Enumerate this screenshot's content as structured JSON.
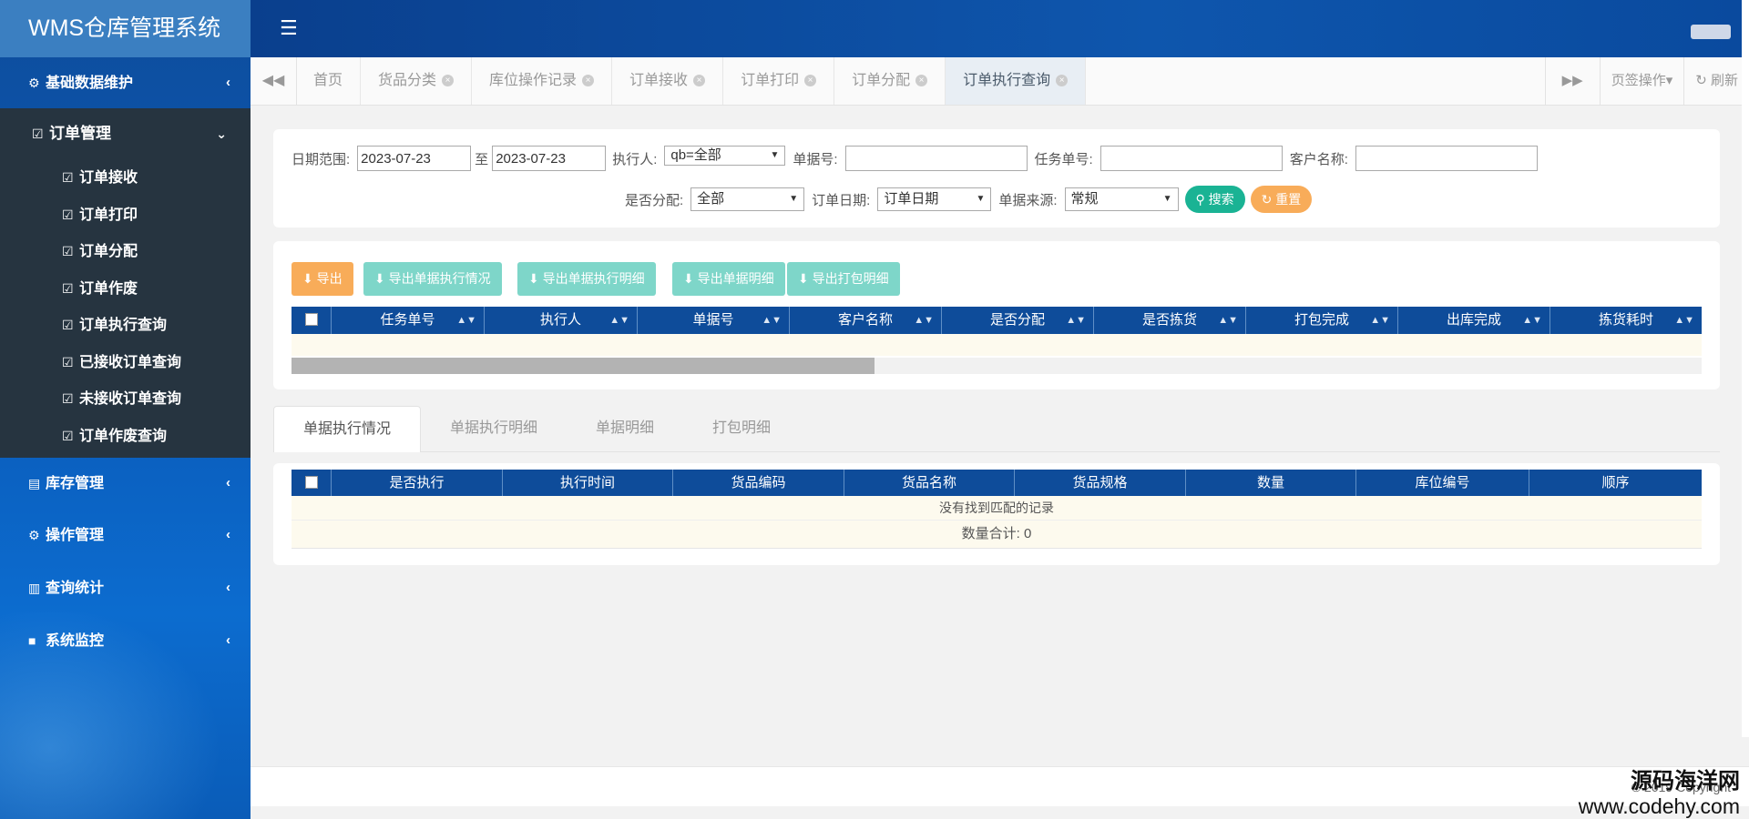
{
  "app": {
    "title": "WMS仓库管理系统"
  },
  "sidebar": {
    "groups": [
      {
        "label": "基础数据维护",
        "icon": "gear-icon"
      },
      {
        "label": "库存管理",
        "icon": "database-icon"
      },
      {
        "label": "操作管理",
        "icon": "cogs-icon"
      },
      {
        "label": "查询统计",
        "icon": "bar-chart-icon"
      },
      {
        "label": "系统监控",
        "icon": "video-camera-icon"
      }
    ],
    "order_section": {
      "label": "订单管理",
      "items": [
        "订单接收",
        "订单打印",
        "订单分配",
        "订单作废",
        "订单执行查询",
        "已接收订单查询",
        "未接收订单查询",
        "订单作废查询"
      ]
    }
  },
  "tabs": {
    "items": [
      {
        "label": "首页",
        "closable": false
      },
      {
        "label": "货品分类",
        "closable": true
      },
      {
        "label": "库位操作记录",
        "closable": true
      },
      {
        "label": "订单接收",
        "closable": true
      },
      {
        "label": "订单打印",
        "closable": true
      },
      {
        "label": "订单分配",
        "closable": true
      },
      {
        "label": "订单执行查询",
        "closable": true,
        "active": true
      }
    ],
    "tab_ops": "页签操作▾",
    "refresh": "刷新"
  },
  "search": {
    "date_range_label": "日期范围:",
    "date_from": "2023-07-23",
    "to_label": "至",
    "date_to": "2023-07-23",
    "executor_label": "执行人:",
    "executor_value": "qb=全部",
    "doc_no_label": "单据号:",
    "task_no_label": "任务单号:",
    "customer_label": "客户名称:",
    "assigned_label": "是否分配:",
    "assigned_value": "全部",
    "order_date_label": "订单日期:",
    "order_date_value": "订单日期",
    "source_label": "单据来源:",
    "source_value": "常规",
    "search_btn": "搜索",
    "reset_btn": "重置"
  },
  "toolbar": {
    "export": "导出",
    "export_exec_status": "导出单据执行情况",
    "export_exec_detail": "导出单据执行明细",
    "export_doc_detail": "导出单据明细",
    "export_pack_detail": "导出打包明细"
  },
  "main_table": {
    "columns": [
      "任务单号",
      "执行人",
      "单据号",
      "客户名称",
      "是否分配",
      "是否拣货",
      "打包完成",
      "出库完成",
      "拣货耗时"
    ]
  },
  "detail_tabs": [
    "单据执行情况",
    "单据执行明细",
    "单据明细",
    "打包明细"
  ],
  "detail_table": {
    "columns": [
      "是否执行",
      "执行时间",
      "货品编码",
      "货品名称",
      "货品规格",
      "数量",
      "库位编号",
      "顺序"
    ],
    "empty_text": "没有找到匹配的记录",
    "total_text": "数量合计: 0"
  },
  "footer": {
    "copyright": "© 2019 Copyright"
  },
  "watermark": {
    "line1": "源码海洋网",
    "line2": "www.codehy.com"
  },
  "colors": {
    "header_blue": "#0e4c9a",
    "sidebar_dark": "#263440",
    "teal": "#1ab394",
    "orange": "#f8ac59"
  }
}
